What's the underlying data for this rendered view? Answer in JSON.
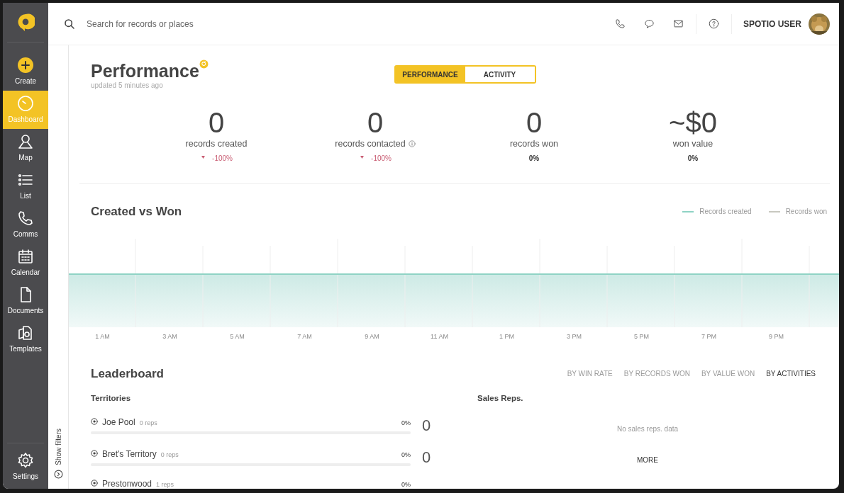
{
  "sidebar": {
    "items": [
      {
        "label": "Create",
        "kind": "create",
        "selected": false
      },
      {
        "label": "Dashboard",
        "kind": "dashboard",
        "selected": true
      },
      {
        "label": "Map",
        "kind": "map",
        "selected": false
      },
      {
        "label": "List",
        "kind": "list",
        "selected": false
      },
      {
        "label": "Comms",
        "kind": "comms",
        "selected": false
      },
      {
        "label": "Calendar",
        "kind": "calendar",
        "selected": false
      },
      {
        "label": "Documents",
        "kind": "documents",
        "selected": false
      },
      {
        "label": "Templates",
        "kind": "templates",
        "selected": false
      }
    ],
    "footer": {
      "label": "Settings"
    }
  },
  "topbar": {
    "search": {
      "placeholder": "Search for records or places"
    },
    "user": "SPOTIO USER"
  },
  "filters": {
    "label": "Show filters"
  },
  "header": {
    "title": "Performance",
    "subtitle": "updated 5 minutes ago",
    "tabs": [
      {
        "label": "PERFORMANCE",
        "selected": true
      },
      {
        "label": "ACTIVITY",
        "selected": false
      }
    ]
  },
  "stats": [
    {
      "value": "0",
      "label": "records created",
      "change": "-100%",
      "decreased": true,
      "info": false
    },
    {
      "value": "0",
      "label": "records contacted",
      "change": "-100%",
      "decreased": true,
      "info": true
    },
    {
      "value": "0",
      "label": "records won",
      "change": "0%",
      "decreased": false,
      "info": false
    },
    {
      "value": "~$0",
      "label": "won value",
      "change": "0%",
      "decreased": false,
      "info": false
    }
  ],
  "chart": {
    "title": "Created vs Won",
    "legend": [
      {
        "name": "Records created",
        "color": "#8fd3c4"
      },
      {
        "name": "Records won",
        "color": "#c8c8c0"
      }
    ],
    "x_labels": [
      "1 AM",
      "3 AM",
      "5 AM",
      "7 AM",
      "9 AM",
      "11 AM",
      "1 PM",
      "3 PM",
      "5 PM",
      "7 PM",
      "9 PM"
    ]
  },
  "leaderboard": {
    "title": "Leaderboard",
    "tabs": [
      {
        "label": "BY WIN RATE",
        "selected": false
      },
      {
        "label": "BY RECORDS WON",
        "selected": false
      },
      {
        "label": "BY VALUE WON",
        "selected": false
      },
      {
        "label": "BY ACTIVITIES",
        "selected": true
      }
    ],
    "territories": {
      "title": "Territories",
      "rows": [
        {
          "name": "Joe Pool",
          "reps": "0 reps",
          "percent": "0%",
          "level": 0,
          "count": "0"
        },
        {
          "name": "Bret's Territory",
          "reps": "0 reps",
          "percent": "0%",
          "level": 0,
          "count": "0"
        },
        {
          "name": "Prestonwood",
          "reps": "1 reps",
          "percent": "0%"
        }
      ]
    },
    "sales_reps": {
      "title": "Sales Reps.",
      "empty": "No sales reps. data",
      "more": "MORE"
    }
  }
}
